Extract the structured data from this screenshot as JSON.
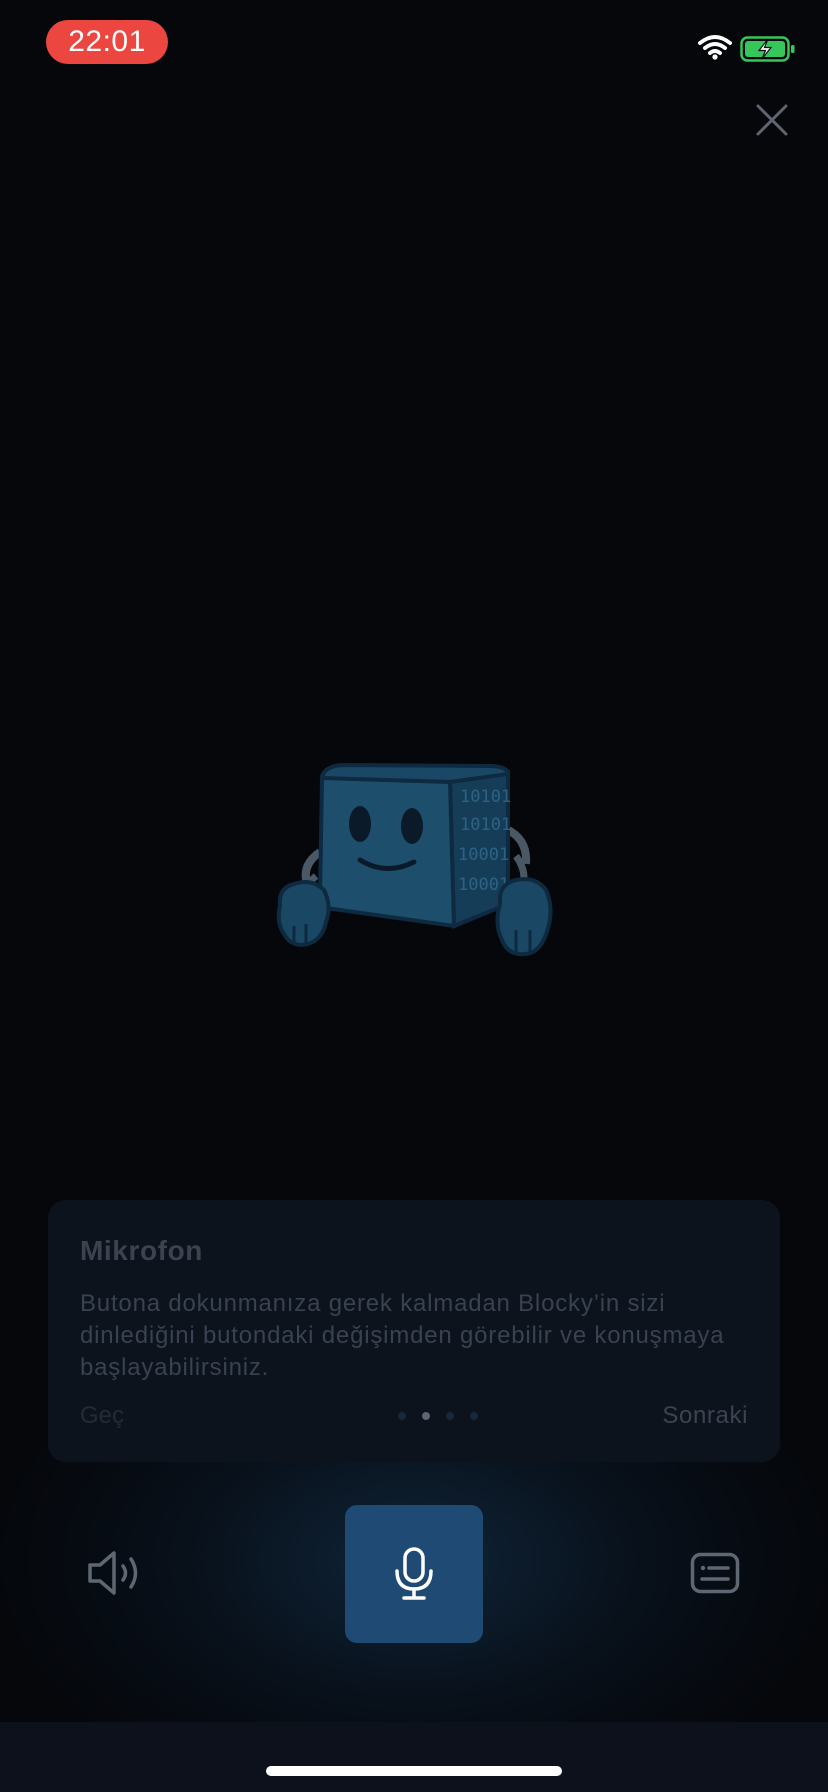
{
  "status_bar": {
    "time": "22:01",
    "icons": [
      "wifi-icon",
      "battery-charging-icon"
    ],
    "time_pill_color": "#eb4640",
    "battery_color": "#35c759"
  },
  "header": {
    "close_icon": "close-icon"
  },
  "mascot": {
    "name": "Blocky",
    "code_text": [
      "10101",
      "10101",
      "10001",
      "10001"
    ]
  },
  "tooltip": {
    "title": "Mikrofon",
    "body": "Butona dokunmanıza gerek kalmadan Blocky’in sizi dinlediğini butondaki değişimden görebilir ve konuşmaya başlayabilirsiniz.",
    "skip_label": "Geç",
    "next_label": "Sonraki",
    "step_count": 4,
    "active_step": 2
  },
  "controls": {
    "speaker_icon": "speaker-icon",
    "mic_icon": "microphone-icon",
    "keyboard_icon": "keyboard-icon",
    "mic_button_color": "#1e4a74"
  }
}
